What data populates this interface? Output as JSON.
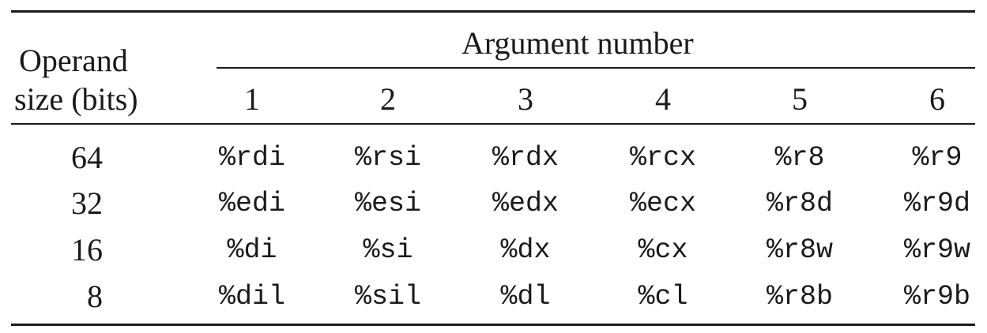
{
  "table": {
    "stub_header_line1": "Operand",
    "stub_header_line2": "size (bits)",
    "spanner": "Argument number",
    "columns": [
      "1",
      "2",
      "3",
      "4",
      "5",
      "6"
    ],
    "rows": [
      {
        "size": "64",
        "regs": [
          "%rdi",
          "%rsi",
          "%rdx",
          "%rcx",
          "%r8",
          "%r9"
        ]
      },
      {
        "size": "32",
        "regs": [
          "%edi",
          "%esi",
          "%edx",
          "%ecx",
          "%r8d",
          "%r9d"
        ]
      },
      {
        "size": "16",
        "regs": [
          "%di",
          "%si",
          "%dx",
          "%cx",
          "%r8w",
          "%r9w"
        ]
      },
      {
        "size": "8",
        "regs": [
          "%dil",
          "%sil",
          "%dl",
          "%cl",
          "%r8b",
          "%r9b"
        ]
      }
    ]
  }
}
